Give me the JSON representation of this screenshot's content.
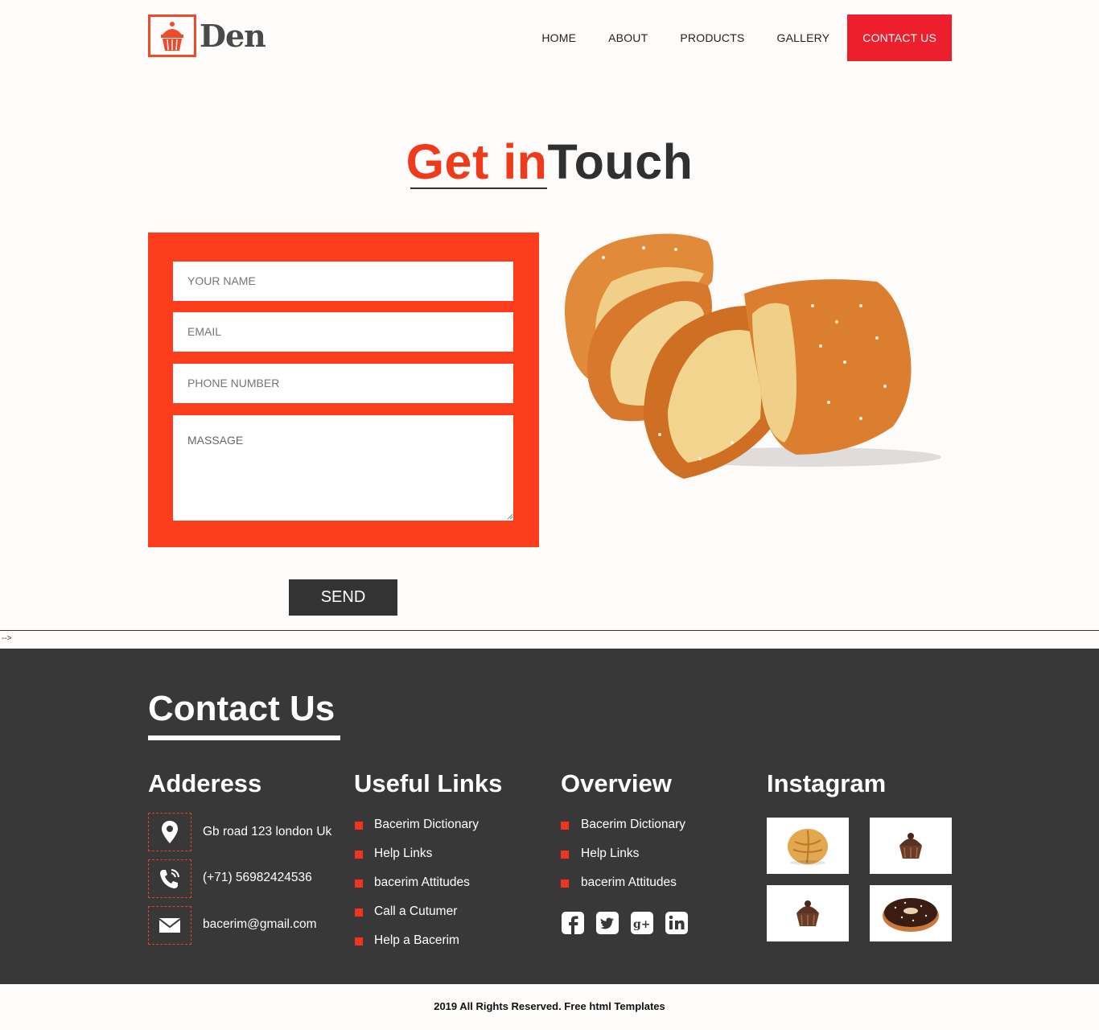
{
  "brand": {
    "name": "Den",
    "accent_color": "#f03a1c",
    "nav_active_color": "#ee1f2d"
  },
  "nav": {
    "items": [
      "HOME",
      "ABOUT",
      "PRODUCTS",
      "GALLERY",
      "CONTACT US"
    ],
    "active": "CONTACT US"
  },
  "hero": {
    "title_highlight": "Get in",
    "title_rest": "Touch"
  },
  "form": {
    "name_placeholder": "YOUR NAME",
    "email_placeholder": "EMAIL",
    "phone_placeholder": "PHONE NUMBER",
    "message_placeholder": "MASSAGE",
    "send_label": "SEND"
  },
  "stray_text": "-->",
  "footer": {
    "title": "Contact Us",
    "address_heading": "Adderess",
    "address": "Gb road 123 london Uk",
    "phone": "(+71) 56982424536",
    "email": "bacerim@gmail.com",
    "useful_links_heading": "Useful Links",
    "useful_links": [
      "Bacerim Dictionary",
      "Help Links",
      "bacerim Attitudes",
      "Call a Cutumer",
      "Help a Bacerim"
    ],
    "overview_heading": "Overview",
    "overview_links": [
      "Bacerim Dictionary",
      "Help Links",
      "bacerim Attitudes"
    ],
    "social_icons": [
      "facebook-icon",
      "twitter-icon",
      "google-plus-icon",
      "linkedin-icon"
    ],
    "instagram_heading": "Instagram",
    "instagram_images": [
      "bread-roll",
      "chocolate-cupcake",
      "chocolate-cupcake",
      "chocolate-donut"
    ]
  },
  "copyright": "2019 All Rights Reserved. Free html Templates"
}
